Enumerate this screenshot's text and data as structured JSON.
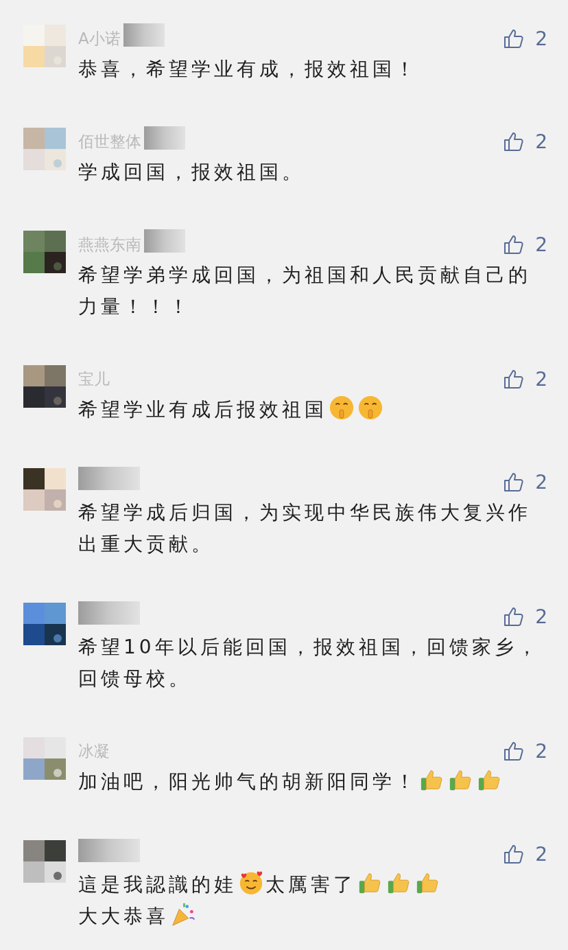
{
  "comments": [
    {
      "name": "A小诺",
      "name_blurred": true,
      "likes": "2",
      "content": [
        {
          "kind": "text",
          "text": "恭喜，希望学业有成，报效祖国！"
        }
      ]
    },
    {
      "name": "佰世整体",
      "name_blurred": true,
      "likes": "2",
      "content": [
        {
          "kind": "text",
          "text": "学成回国，报效祖国。"
        }
      ]
    },
    {
      "name": "燕燕东南",
      "name_blurred": true,
      "likes": "2",
      "content": [
        {
          "kind": "text",
          "text": "希望学弟学成回国，为祖国和人民贡献自己的力量！！！"
        }
      ]
    },
    {
      "name": "宝儿",
      "name_blurred": false,
      "likes": "2",
      "content": [
        {
          "kind": "text",
          "text": "希望学业有成后报效祖国"
        },
        {
          "kind": "shush"
        },
        {
          "kind": "shush"
        }
      ]
    },
    {
      "name_blurred": true,
      "likes": "2",
      "content": [
        {
          "kind": "text",
          "text": "希望学成后归国，为实现中华民族伟大复兴作出重大贡献。"
        }
      ]
    },
    {
      "name_blurred": true,
      "likes": "2",
      "content": [
        {
          "kind": "text",
          "text": "希望10年以后能回国，报效祖国，回馈家乡，回馈母校。"
        }
      ]
    },
    {
      "name": "冰凝",
      "name_blurred": false,
      "likes": "2",
      "content": [
        {
          "kind": "text",
          "text": "加油吧，阳光帅气的胡新阳同学！"
        },
        {
          "kind": "thumbs"
        },
        {
          "kind": "thumbs"
        },
        {
          "kind": "thumbs"
        }
      ]
    },
    {
      "name_blurred": true,
      "likes": "2",
      "content": [
        {
          "kind": "text",
          "text": "這是我認識的娃"
        },
        {
          "kind": "hearts"
        },
        {
          "kind": "text",
          "text": "太厲害了"
        },
        {
          "kind": "thumbs"
        },
        {
          "kind": "thumbs"
        },
        {
          "kind": "thumbs"
        },
        {
          "kind": "break"
        },
        {
          "kind": "text",
          "text": "大大恭喜"
        },
        {
          "kind": "party"
        }
      ]
    }
  ]
}
